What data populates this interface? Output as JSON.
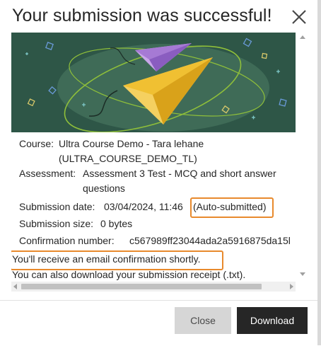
{
  "dialog": {
    "title": "Your submission was successful!",
    "close_icon": "close-icon"
  },
  "details": {
    "course_label": "Course:",
    "course_line1": "Ultra Course Demo - Tara lehane",
    "course_line2": "(ULTRA_COURSE_DEMO_TL)",
    "assessment_label": "Assessment:",
    "assessment_line1": "Assessment 3 Test - MCQ and short answer",
    "assessment_line2": "questions",
    "date_label": "Submission date:",
    "date_value": "03/04/2024, 11:46",
    "auto_submitted": "(Auto-submitted)",
    "size_label": "Submission size:",
    "size_value": "0 bytes",
    "confirmation_label": "Confirmation number:",
    "confirmation_value": "c567989ff23044ada2a5916875da15l"
  },
  "notices": {
    "email": "You'll receive an email confirmation shortly.",
    "receipt": "You can also download your submission receipt (.txt)."
  },
  "footer": {
    "close_label": "Close",
    "download_label": "Download"
  },
  "colors": {
    "hero_bg": "#2e5647",
    "highlight": "#e88a2d",
    "primary_button": "#262626",
    "secondary_button": "#d6d6d6"
  }
}
